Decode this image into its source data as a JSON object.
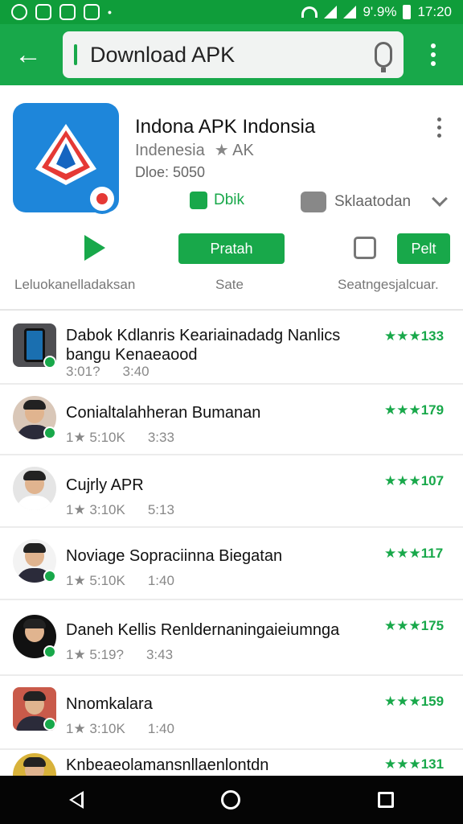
{
  "status_bar": {
    "time": "17:20",
    "battery": "9'.9%"
  },
  "toolbar": {
    "back_label": "←",
    "search_value": "Download APK"
  },
  "app": {
    "title": "Indona APK Indonsia",
    "developer": "Indenesia",
    "dev_rating_star": "★",
    "dev_rating_text": "AK",
    "meta": "Dloe: 5050",
    "chip_green": "Dbik",
    "chip_gray": "Sklaatodan",
    "action_primary": "Pratah",
    "action_secondary": "Pelt",
    "label_1": "Leluokanelladaksan",
    "label_2": "Sate",
    "label_3": "Seatngesjalcuar."
  },
  "rows": [
    {
      "title": "Dabok Kdlanris Keariainadadg Nanlics",
      "title2": "bangu Kenaeaood",
      "meta_size": "3:01?",
      "meta_time": "3:40",
      "rating": "★★★133"
    },
    {
      "title": "Conialtalahheran Bumanan",
      "meta_size": "1★ 5:10K",
      "meta_time": "3:33",
      "rating": "★★★179"
    },
    {
      "title": "Cujrly APR",
      "meta_size": "1★ 3:10K",
      "meta_time": "5:13",
      "rating": "★★★107"
    },
    {
      "title": "Noviage Sopraciinna Biegatan",
      "meta_size": "1★ 5:10K",
      "meta_time": "1:40",
      "rating": "★★★117"
    },
    {
      "title": "Daneh Kellis Renldernaningaieiumnga",
      "meta_size": "1★ 5:19?",
      "meta_time": "3:43",
      "rating": "★★★175"
    },
    {
      "title": "Nnomkalara",
      "meta_size": "1★ 3:10K",
      "meta_time": "1:40",
      "rating": "★★★159"
    },
    {
      "title": "Knbeaeolamansnllaenlontdn",
      "meta_size": "",
      "meta_time": "",
      "rating": "★★★131"
    }
  ]
}
